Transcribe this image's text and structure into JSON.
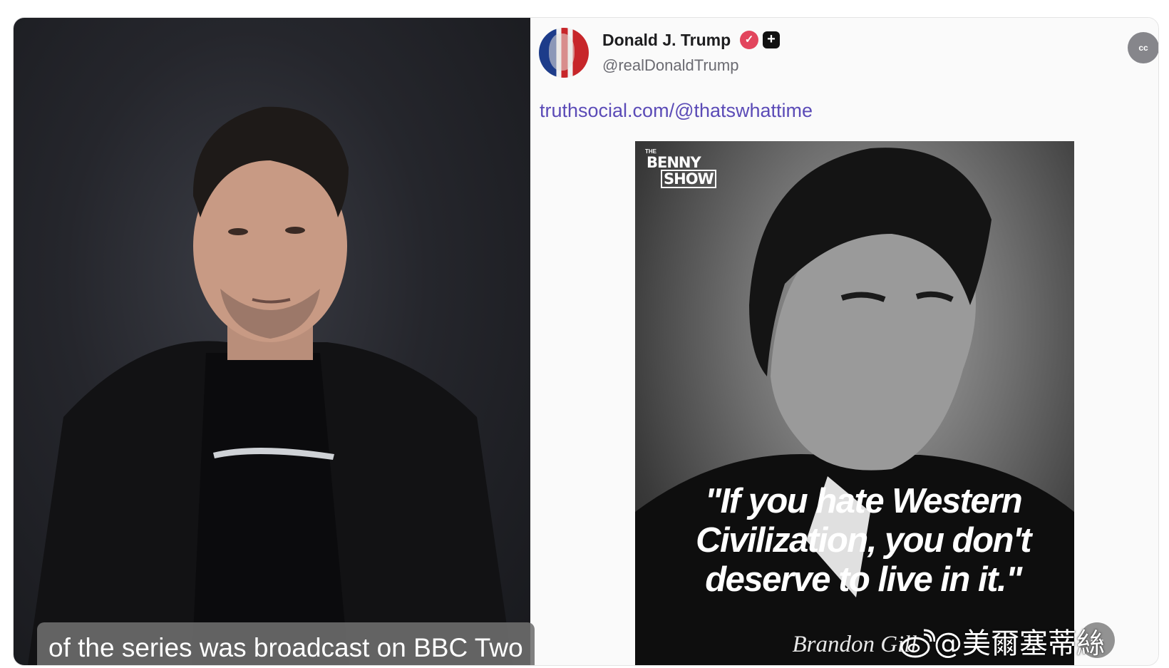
{
  "subtitle": {
    "text": "of the series was broadcast on BBC Two"
  },
  "post": {
    "display_name": "Donald J. Trump",
    "handle": "@realDonaldTrump",
    "link_text": "truthsocial.com/@thatswhattime",
    "cc_label": "cc",
    "image": {
      "logo_small": "THE",
      "logo_line1": "BENNY",
      "logo_line2": "SHOW",
      "quote": "\"If you hate Western Civilization, you don't deserve to live in it.\"",
      "attribution": "Brandon Gill"
    }
  },
  "watermark": {
    "text": "@美爾塞蒂絲"
  },
  "colors": {
    "link": "#5b4bb7",
    "verified": "#e2455d",
    "handle": "#6b6b72"
  },
  "icons": [
    "verified-badge-icon",
    "plus-badge-icon",
    "cc-icon",
    "weibo-icon"
  ]
}
